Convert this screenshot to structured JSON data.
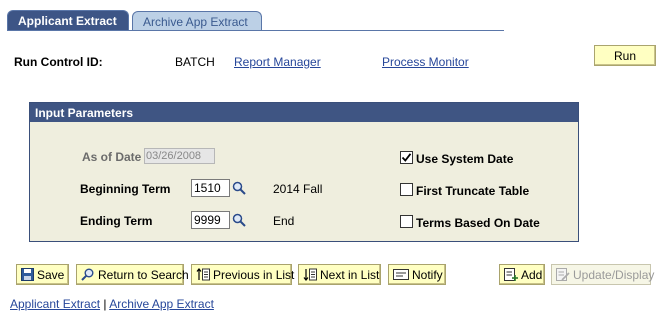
{
  "tabs": [
    {
      "label": "Applicant Extract",
      "active": true
    },
    {
      "label": "Archive App Extract",
      "active": false
    }
  ],
  "run_control": {
    "label": "Run Control ID:",
    "value": "BATCH",
    "report_manager": "Report Manager",
    "process_monitor": "Process Monitor",
    "run_button": "Run"
  },
  "input_parameters": {
    "title": "Input Parameters",
    "as_of_date": {
      "label": "As of Date",
      "value": "03/26/2008"
    },
    "beginning_term": {
      "label": "Beginning Term",
      "value": "1510",
      "description": "2014 Fall"
    },
    "ending_term": {
      "label": "Ending Term",
      "value": "9999",
      "description": "End"
    },
    "use_system_date": {
      "label": "Use System Date",
      "checked": true
    },
    "first_truncate_table": {
      "label": "First Truncate Table",
      "checked": false
    },
    "terms_based_on_date": {
      "label": "Terms Based On Date",
      "checked": false
    }
  },
  "toolbar": {
    "save": "Save",
    "return_to_search": "Return to Search",
    "previous_in_list": "Previous in List",
    "next_in_list": "Next in List",
    "notify": "Notify",
    "add": "Add",
    "update_display": "Update/Display"
  },
  "footer": {
    "link1": "Applicant Extract",
    "separator": "|",
    "link2": "Archive App Extract"
  },
  "colors": {
    "tab_active_bg": "#3d5586",
    "tab_inactive_bg": "#bcd0e6",
    "group_header_bg": "#3f5583",
    "group_body_bg": "#efeede",
    "button_bg": "#ffffc2",
    "link": "#27479a"
  }
}
